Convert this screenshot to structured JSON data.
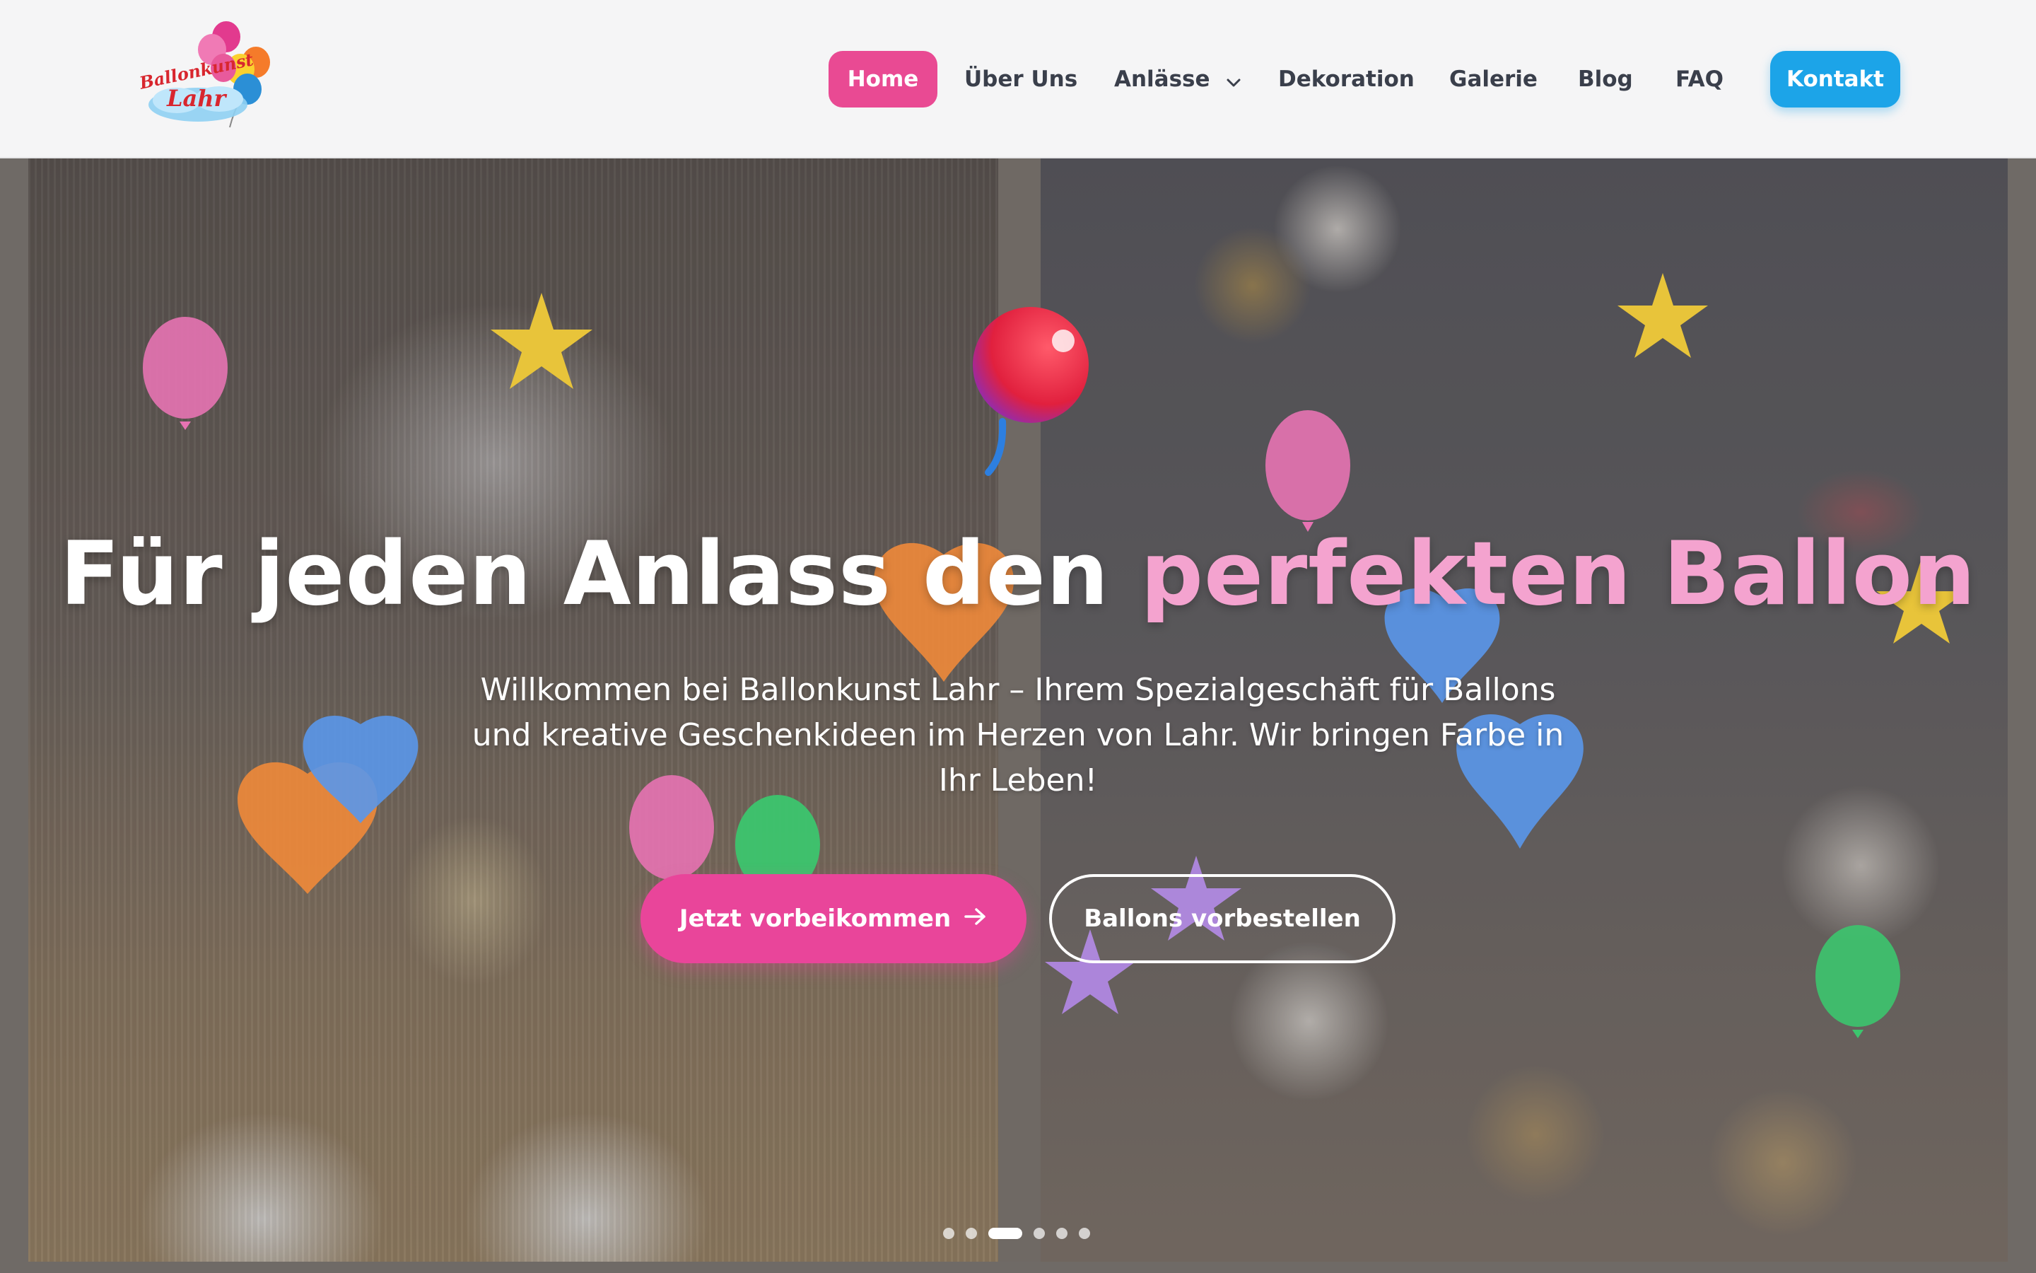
{
  "header": {
    "logo": {
      "alt": "Ballonkunst Lahr",
      "text_top": "Ballonkunst",
      "text_bottom": "Lahr"
    },
    "nav": [
      {
        "label": "Home",
        "active": true
      },
      {
        "label": "Über Uns"
      },
      {
        "label": "Anlässe",
        "has_dropdown": true,
        "icon": "chevron-down-icon"
      },
      {
        "label": "Dekoration"
      },
      {
        "label": "Galerie"
      },
      {
        "label": "Blog"
      },
      {
        "label": "FAQ"
      },
      {
        "label": "Kontakt",
        "style": "button"
      }
    ]
  },
  "hero": {
    "title_main": "Für jeden Anlass den ",
    "title_accent": "perfekten Ballon",
    "subtitle": "Willkommen bei Ballonkunst Lahr – Ihrem Spezialgeschäft für Ballons und kreative Geschenkideen im Herzen von Lahr. Wir bringen Farbe in Ihr Leben!",
    "primary_button": "Jetzt vorbeikommen",
    "primary_button_icon": "arrow-right-icon",
    "secondary_button": "Ballons vorbestellen",
    "carousel": {
      "slides": 6,
      "active_index": 2
    }
  },
  "colors": {
    "brand_pink": "#e94a93",
    "brand_blue": "#1ca4e8",
    "accent_pink_text": "#f4a3cf",
    "header_bg": "#f5f5f6",
    "nav_text": "#3a3f4b"
  }
}
